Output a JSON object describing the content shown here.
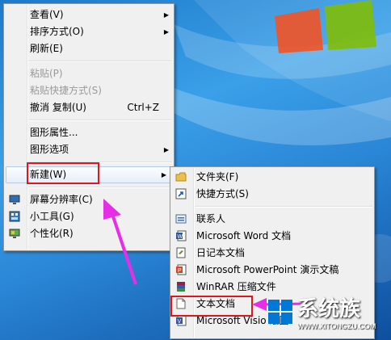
{
  "context_menu": {
    "items": [
      {
        "label": "查看(V)",
        "submenu": true
      },
      {
        "label": "排序方式(O)",
        "submenu": true
      },
      {
        "label": "刷新(E)"
      },
      {
        "label": "粘贴(P)",
        "disabled": true
      },
      {
        "label": "粘贴快捷方式(S)",
        "disabled": true
      },
      {
        "label": "撤消 复制(U)",
        "shortcut": "Ctrl+Z"
      },
      {
        "label": "图形属性..."
      },
      {
        "label": "图形选项",
        "submenu": true
      },
      {
        "label": "新建(W)",
        "submenu": true,
        "highlighted": true
      },
      {
        "label": "屏幕分辨率(C)",
        "icon": "display-icon"
      },
      {
        "label": "小工具(G)",
        "icon": "gadgets-icon"
      },
      {
        "label": "个性化(R)",
        "icon": "personalize-icon"
      }
    ]
  },
  "new_submenu": {
    "items": [
      {
        "label": "文件夹(F)",
        "icon": "folder-icon"
      },
      {
        "label": "快捷方式(S)",
        "icon": "shortcut-icon"
      },
      {
        "label": "联系人",
        "icon": "contact-icon"
      },
      {
        "label": "Microsoft Word 文档",
        "icon": "word-icon"
      },
      {
        "label": "日记本文档",
        "icon": "journal-icon"
      },
      {
        "label": "Microsoft PowerPoint 演示文稿",
        "icon": "powerpoint-icon"
      },
      {
        "label": "WinRAR 压缩文件",
        "icon": "winrar-icon"
      },
      {
        "label": "文本文档",
        "icon": "text-document-icon"
      },
      {
        "label": "Microsoft Visio 绘图",
        "icon": "visio-icon"
      }
    ]
  },
  "watermark": {
    "brand": "系统族",
    "url": "WWW.XITONGZU.COM"
  },
  "colors": {
    "annotation_red": "#e3141b",
    "arrow_magenta": "#e62ee6"
  }
}
